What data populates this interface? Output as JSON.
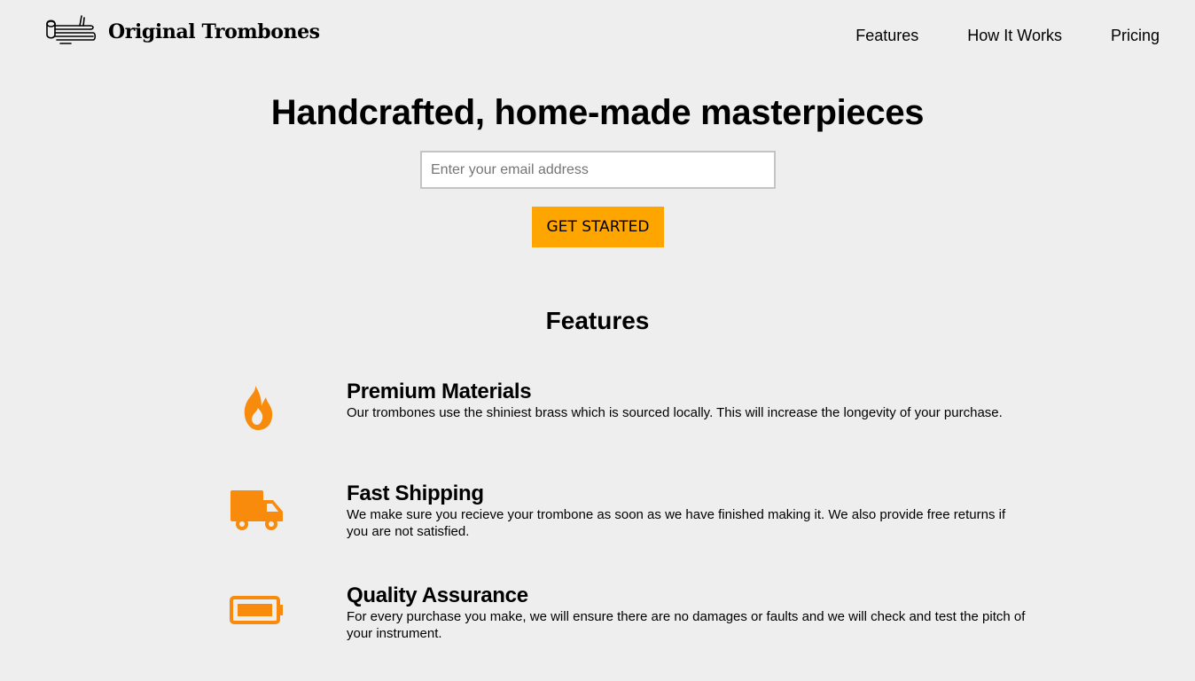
{
  "header": {
    "brand": "Original Trombones",
    "logo_icon": "trombone-icon",
    "nav": [
      {
        "label": "Features"
      },
      {
        "label": "How It Works"
      },
      {
        "label": "Pricing"
      }
    ]
  },
  "hero": {
    "title": "Handcrafted, home-made masterpieces",
    "email_placeholder": "Enter your email address",
    "email_value": "",
    "cta_label": "GET STARTED"
  },
  "features": {
    "heading": "Features",
    "items": [
      {
        "icon": "fire-icon",
        "title": "Premium Materials",
        "text": "Our trombones use the shiniest brass which is sourced locally. This will increase the longevity of your purchase."
      },
      {
        "icon": "truck-icon",
        "title": "Fast Shipping",
        "text": "We make sure you recieve your trombone as soon as we have finished making it. We also provide free returns if you are not satisfied."
      },
      {
        "icon": "battery-full-icon",
        "title": "Quality Assurance",
        "text": "For every purchase you make, we will ensure there are no damages or faults and we will check and test the pitch of your instrument."
      }
    ]
  },
  "colors": {
    "background": "#eeeeee",
    "accent": "#ffa500",
    "icon": "#f88a0c"
  }
}
